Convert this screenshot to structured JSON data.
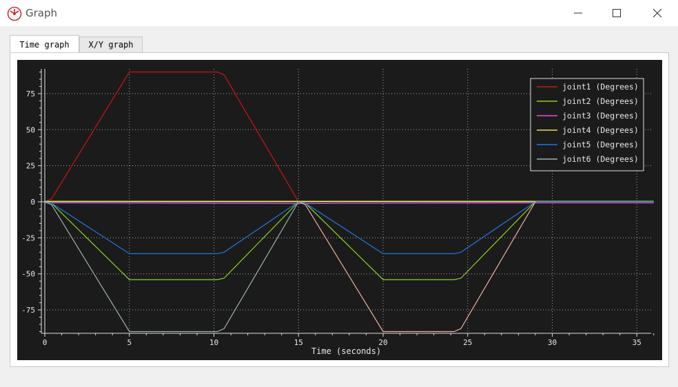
{
  "window": {
    "title": "Graph",
    "icon": "app-logo-icon",
    "controls": [
      "minimize-icon",
      "maximize-icon",
      "close-icon"
    ]
  },
  "tabs": [
    {
      "label": "Time graph",
      "active": true
    },
    {
      "label": "X/Y graph",
      "active": false
    }
  ],
  "chart_data": {
    "type": "line",
    "xlabel": "Time (seconds)",
    "ylabel": "",
    "xlim": [
      -0.3,
      36
    ],
    "ylim": [
      -92,
      92
    ],
    "xticks": [
      0,
      5,
      10,
      15,
      20,
      25,
      30,
      35
    ],
    "yticks": [
      75,
      50,
      25,
      0,
      -25,
      -50,
      -75
    ],
    "grid": true,
    "legend_position": "top-right",
    "background": "#1b1b1b",
    "series": [
      {
        "name": "joint1 (Degrees)",
        "color": "#d21414",
        "x": [
          0,
          0.4,
          5,
          10.2,
          10.6,
          15
        ],
        "y": [
          0,
          2,
          90,
          90,
          88,
          0
        ]
      },
      {
        "name": "joint2 (Degrees)",
        "color": "#8fd21e",
        "x": [
          0,
          0.4,
          5,
          10.2,
          10.6,
          15,
          15.4,
          20,
          24.2,
          24.6,
          29,
          36
        ],
        "y": [
          0,
          -1,
          -54,
          -54,
          -53,
          0,
          -1,
          -54,
          -54,
          -53,
          0,
          0
        ]
      },
      {
        "name": "joint3 (Degrees)",
        "color": "#e650e6",
        "x": [
          0,
          15,
          29,
          36
        ],
        "y": [
          -0.8,
          -1.2,
          -0.8,
          -0.8
        ]
      },
      {
        "name": "joint4 (Degrees)",
        "color": "#e6e646",
        "x": [
          0,
          36
        ],
        "y": [
          0.4,
          0.4
        ]
      },
      {
        "name": "joint5 (Degrees)",
        "color": "#1e78dc",
        "x": [
          0,
          0.4,
          5,
          10.2,
          10.6,
          15,
          15.4,
          20,
          24.2,
          24.6,
          29,
          36
        ],
        "y": [
          0,
          -1,
          -36,
          -36,
          -35,
          0,
          -1,
          -36,
          -36,
          -35,
          0,
          0
        ]
      },
      {
        "name": "joint6 (Degrees)",
        "color": "#a0b4b4",
        "x": [
          0,
          0.4,
          5,
          10.2,
          10.6,
          15
        ],
        "y": [
          0,
          -2,
          -90,
          -90,
          -88,
          0
        ]
      },
      {
        "name": "",
        "color": "#f0b4a0",
        "x": [
          15,
          15.4,
          20,
          24.2,
          24.6,
          29
        ],
        "y": [
          0,
          -2,
          -90,
          -90,
          -88,
          0
        ]
      }
    ]
  }
}
